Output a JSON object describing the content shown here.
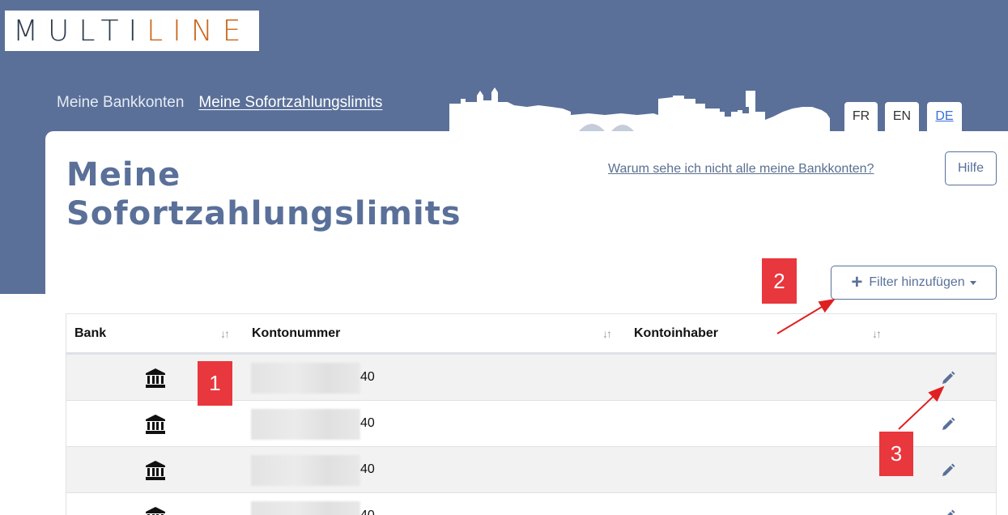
{
  "logo": {
    "part1": "MULTI",
    "part2": "LINE"
  },
  "nav": {
    "item1": "Meine Bankkonten",
    "item2": "Meine Sofortzahlungslimits"
  },
  "languages": [
    "FR",
    "EN",
    "DE"
  ],
  "page": {
    "title": "Meine Sofortzahlungslimits",
    "why_link": "Warum sehe ich nicht alle meine Bankkonten?",
    "help_label": "Hilfe",
    "filter_label": "Filter hinzufügen"
  },
  "table": {
    "columns": [
      "Bank",
      "Kontonummer",
      "Kontoinhaber"
    ],
    "rows": [
      {
        "account_suffix": "40"
      },
      {
        "account_suffix": "40"
      },
      {
        "account_suffix": "40"
      },
      {
        "account_suffix": "40"
      }
    ]
  },
  "callouts": [
    "1",
    "2",
    "3"
  ],
  "colors": {
    "header": "#5a7099",
    "accent": "#c9661b",
    "callout": "#e8373d"
  },
  "icons": [
    "bank-icon",
    "edit-icon",
    "plus-icon",
    "sort-icon",
    "caret-down-icon"
  ]
}
